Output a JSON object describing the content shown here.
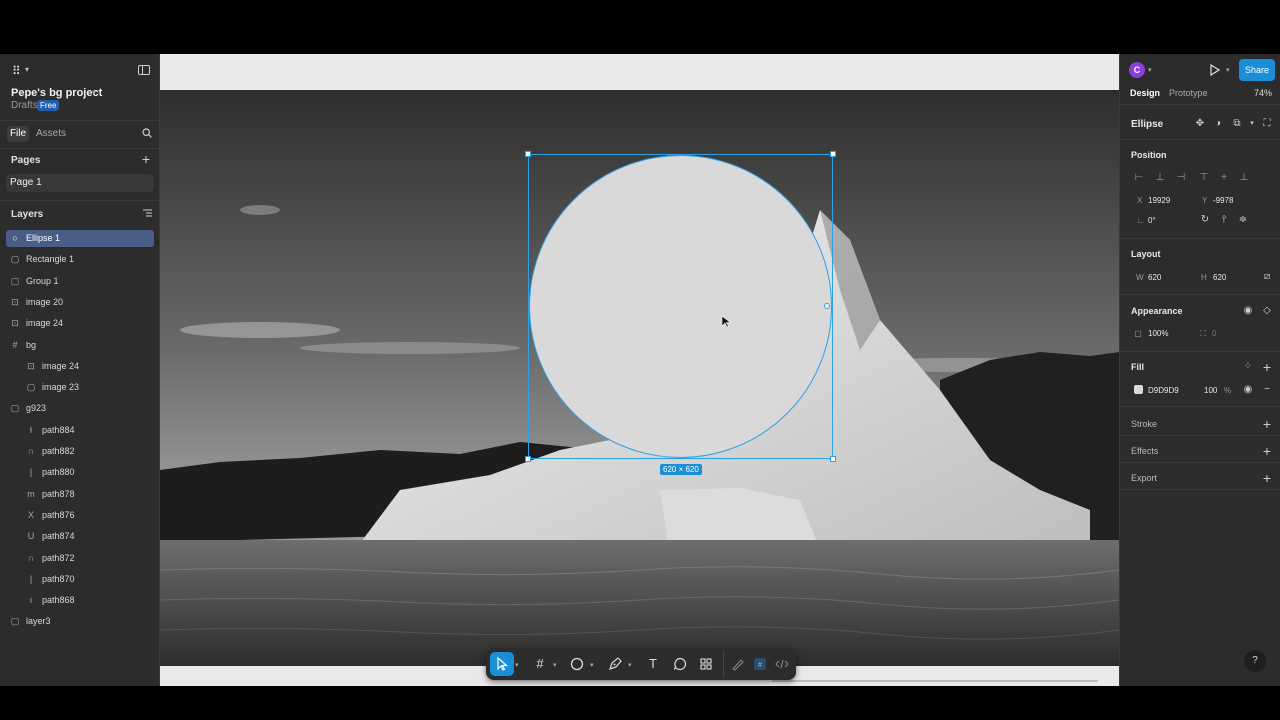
{
  "project": {
    "name": "Pepe's bg project",
    "location": "Drafts",
    "plan_badge": "Free"
  },
  "left_tabs": {
    "file": "File",
    "assets": "Assets"
  },
  "pages": {
    "title": "Pages",
    "items": [
      "Page 1"
    ]
  },
  "layers": {
    "title": "Layers",
    "items": [
      {
        "label": "Ellipse 1",
        "icon": "ellipse-icon",
        "glyph": "○",
        "indent": 0,
        "selected": true
      },
      {
        "label": "Rectangle 1",
        "icon": "rectangle-icon",
        "glyph": "▢",
        "indent": 0
      },
      {
        "label": "Group 1",
        "icon": "group-icon",
        "glyph": "▢",
        "indent": 0
      },
      {
        "label": "image 20",
        "icon": "image-icon",
        "glyph": "⊡",
        "indent": 0
      },
      {
        "label": "image 24",
        "icon": "image-icon",
        "glyph": "⊡",
        "indent": 0
      },
      {
        "label": "bg",
        "icon": "frame-icon",
        "glyph": "#",
        "indent": 0
      },
      {
        "label": "image 24",
        "icon": "image-icon",
        "glyph": "⊡",
        "indent": 1
      },
      {
        "label": "image 23",
        "icon": "image-icon",
        "glyph": "▢",
        "indent": 1
      },
      {
        "label": "g923",
        "icon": "group-icon",
        "glyph": "▢",
        "indent": 0
      },
      {
        "label": "path884",
        "icon": "vector-icon",
        "glyph": "ƚ",
        "indent": 1
      },
      {
        "label": "path882",
        "icon": "vector-icon",
        "glyph": "∩",
        "indent": 1
      },
      {
        "label": "path880",
        "icon": "vector-icon",
        "glyph": "|",
        "indent": 1
      },
      {
        "label": "path878",
        "icon": "vector-icon",
        "glyph": "m",
        "indent": 1
      },
      {
        "label": "path876",
        "icon": "vector-icon",
        "glyph": "X",
        "indent": 1
      },
      {
        "label": "path874",
        "icon": "vector-icon",
        "glyph": "U",
        "indent": 1
      },
      {
        "label": "path872",
        "icon": "vector-icon",
        "glyph": "∩",
        "indent": 1
      },
      {
        "label": "path870",
        "icon": "vector-icon",
        "glyph": "|",
        "indent": 1
      },
      {
        "label": "path868",
        "icon": "vector-icon",
        "glyph": "ı",
        "indent": 1
      },
      {
        "label": "layer3",
        "icon": "group-icon",
        "glyph": "▢",
        "indent": 0
      }
    ]
  },
  "canvas": {
    "selection_size_label": "620 × 620"
  },
  "header": {
    "avatar_initial": "C",
    "share_label": "Share"
  },
  "right_tabs": {
    "design": "Design",
    "prototype": "Prototype",
    "zoom": "74%"
  },
  "properties": {
    "element_type": "Ellipse",
    "position_title": "Position",
    "x_label": "X",
    "x_value": "19929",
    "y_label": "Y",
    "y_value": "-9978",
    "rotation_label": "∟",
    "rotation_value": "0°",
    "layout_title": "Layout",
    "w_label": "W",
    "w_value": "620",
    "h_label": "H",
    "h_value": "620",
    "appearance_title": "Appearance",
    "opacity_value": "100%",
    "radius_value": "0",
    "fill_title": "Fill",
    "fill_hex": "D9D9D9",
    "fill_opacity": "100",
    "fill_opacity_unit": "%",
    "stroke_title": "Stroke",
    "effects_title": "Effects",
    "export_title": "Export"
  },
  "colors": {
    "accent": "#1a8fd8",
    "selection": "#2ea1e5",
    "fill": "#d9d9d9",
    "panel": "#2c2c2c"
  },
  "help": "?"
}
